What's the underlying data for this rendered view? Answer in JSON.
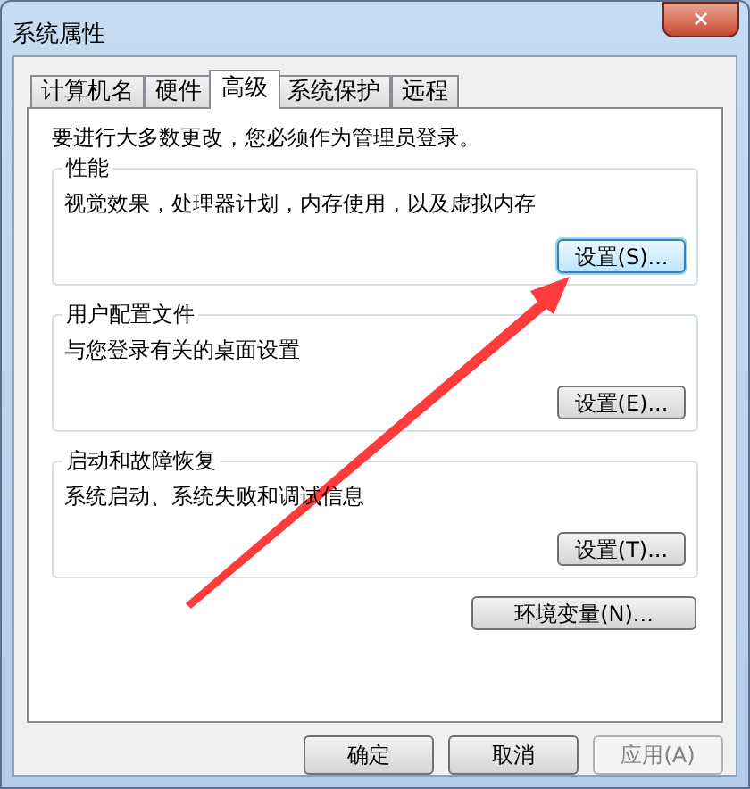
{
  "window": {
    "title": "系统属性",
    "close": "✕"
  },
  "tabs": [
    {
      "label": "计算机名",
      "selected": false
    },
    {
      "label": "硬件",
      "selected": false
    },
    {
      "label": "高级",
      "selected": true
    },
    {
      "label": "系统保护",
      "selected": false
    },
    {
      "label": "远程",
      "selected": false
    }
  ],
  "notice": "要进行大多数更改，您必须作为管理员登录。",
  "groups": [
    {
      "title": "性能",
      "description": "视觉效果，处理器计划，内存使用，以及虚拟内存",
      "button": {
        "label": "设置(S)...",
        "focused": true
      }
    },
    {
      "title": "用户配置文件",
      "description": "与您登录有关的桌面设置",
      "button": {
        "label": "设置(E)...",
        "focused": false
      }
    },
    {
      "title": "启动和故障恢复",
      "description": "系统启动、系统失败和调试信息",
      "button": {
        "label": "设置(T)...",
        "focused": false
      }
    }
  ],
  "env_button": "环境变量(N)...",
  "buttons": [
    {
      "label": "确定",
      "disabled": false
    },
    {
      "label": "取消",
      "disabled": false
    },
    {
      "label": "应用(A)",
      "disabled": true
    }
  ]
}
